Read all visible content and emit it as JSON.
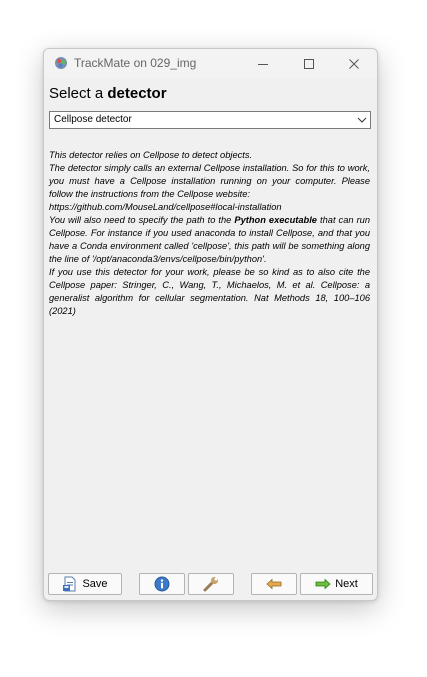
{
  "window": {
    "title": "TrackMate on 029_img"
  },
  "heading": {
    "prefix": "Select a ",
    "bold": "detector"
  },
  "detector_select": {
    "selected": "Cellpose detector"
  },
  "description": {
    "line1": "This detector relies on Cellpose to detect objects.",
    "para2": "The detector simply calls an external Cellpose installation. So for this to work, you must have a Cellpose installation running on your computer. Please follow the instructions from the Cellpose website:",
    "url": "https://github.com/MouseLand/cellpose#local-installation",
    "para3_before": "You will also need to specify the path to the ",
    "para3_bold": "Python executable",
    "para3_after": " that can run Cellpose. For instance if you used anaconda to install Cellpose, and that you have a Conda environment called 'cellpose', this path will be something along the line of '/opt/anaconda3/envs/cellpose/bin/python'.",
    "para4": "If you use this detector for your work, please be so kind as to also cite the Cellpose paper: Stringer, C., Wang, T., Michaelos, M. et al. Cellpose: a generalist algorithm for cellular segmentation. Nat Methods 18, 100–106 (2021)"
  },
  "buttons": {
    "save": "Save",
    "next": "Next"
  },
  "icons": {
    "app": "trackmate-icon",
    "minimize": "minimize-icon",
    "maximize": "maximize-icon",
    "close": "close-icon",
    "save": "save-icon",
    "info": "info-icon",
    "settings": "wrench-icon",
    "previous": "arrow-left-icon",
    "next": "arrow-right-icon",
    "dropdown": "chevron-down-icon"
  }
}
